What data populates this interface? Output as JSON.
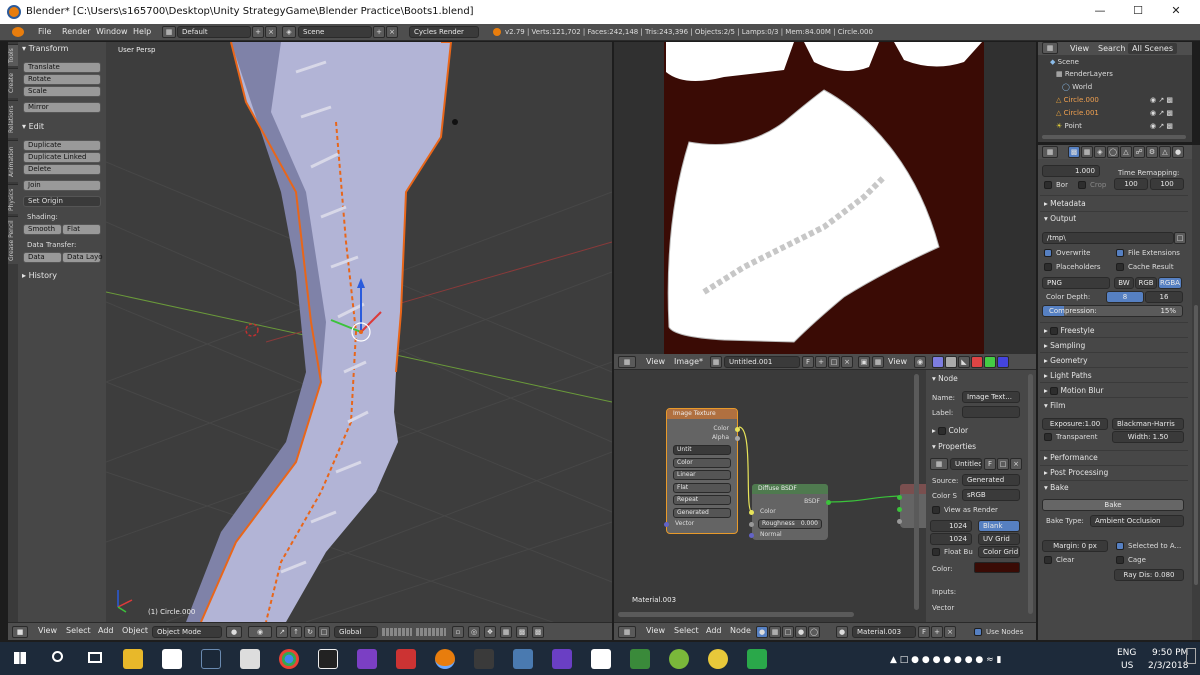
{
  "titlebar": {
    "title": "Blender* [C:\\Users\\s165700\\Desktop\\Unity StrategyGame\\Blender Practice\\Boots1.blend]"
  },
  "infobar": {
    "menus": [
      "File",
      "Render",
      "Window",
      "Help"
    ],
    "screen": "Default",
    "scene": "Scene",
    "engine": "Cycles Render",
    "stats": "v2.79 | Verts:121,702 | Faces:242,148 | Tris:243,396 | Objects:2/5 | Lamps:0/3 | Mem:84.00M | Circle.000"
  },
  "toolshelf": {
    "tabs": [
      "Tools",
      "Create",
      "Relations",
      "Animation",
      "Physics",
      "Grease Pencil"
    ],
    "transform_header": "Transform",
    "translate": "Translate",
    "rotate": "Rotate",
    "scale": "Scale",
    "mirror": "Mirror",
    "edit_header": "Edit",
    "duplicate": "Duplicate",
    "duplicate_linked": "Duplicate Linked",
    "delete": "Delete",
    "join": "Join",
    "set_origin": "Set Origin",
    "shading_label": "Shading:",
    "smooth": "Smooth",
    "flat": "Flat",
    "data_transfer_label": "Data Transfer:",
    "data": "Data",
    "data_layout": "Data Layo",
    "history_header": "History"
  },
  "viewport": {
    "view_label": "User Persp",
    "object_label": "(1) Circle.000",
    "menus": [
      "View",
      "Select",
      "Add",
      "Object"
    ],
    "mode": "Object Mode",
    "orientation": "Global"
  },
  "image_editor": {
    "menus": [
      "View",
      "Image*"
    ],
    "image_name": "Untitled.001",
    "view_menu": "View",
    "colors": {
      "background": "#3a0b05",
      "island": "#ffffff"
    }
  },
  "node_editor": {
    "image_texture": {
      "title": "Image Texture",
      "out_color": "Color",
      "out_alpha": "Alpha",
      "image_field": "Untit",
      "color_space": "Color",
      "interpolation": "Linear",
      "projection": "Flat",
      "extension": "Repeat",
      "source": "Generated",
      "in_vector": "Vector"
    },
    "diffuse": {
      "title": "Diffuse BSDF",
      "out_bsdf": "BSDF",
      "in_color": "Color",
      "roughness_label": "Roughness",
      "roughness_value": "0.000",
      "in_normal": "Normal"
    },
    "material_label": "Material.003",
    "footer_menus": [
      "View",
      "Select",
      "Add",
      "Node"
    ],
    "footer_material": "Material.003",
    "use_nodes": "Use Nodes"
  },
  "node_panel": {
    "node_header": "Node",
    "name_label": "Name:",
    "name_value": "Image Text...",
    "label_label": "Label:",
    "color_header": "Color",
    "properties_header": "Properties",
    "image_name": "Untitled.",
    "image_f": "F",
    "source_label": "Source:",
    "source_value": "Generated",
    "colorspace_label": "Color S",
    "colorspace_value": "sRGB",
    "view_as_render": "View as Render",
    "width": "1024",
    "height": "1024",
    "float_buffer": "Float Bu",
    "gen_types": [
      "Blank",
      "UV Grid",
      "Color Grid"
    ],
    "color_label": "Color:",
    "inputs_label": "Inputs:",
    "vector_label": "Vector"
  },
  "outliner": {
    "menus": [
      "View",
      "Search",
      "All Scenes"
    ],
    "items": [
      "Scene",
      "RenderLayers",
      "World",
      "Circle.000",
      "Circle.001",
      "Point"
    ]
  },
  "properties": {
    "y_label": "Y:",
    "y_value": "1.000",
    "time_remap": "Time Remapping:",
    "bor": "Bor",
    "crop": "Crop",
    "remap_old": "100",
    "remap_new": "100",
    "metadata": "Metadata",
    "output": "Output",
    "output_path": "/tmp\\",
    "overwrite": "Overwrite",
    "file_extensions": "File Extensions",
    "placeholders": "Placeholders",
    "cache_result": "Cache Result",
    "format": "PNG",
    "bw": "BW",
    "rgb": "RGB",
    "rgba": "RGBA",
    "color_depth": "Color Depth:",
    "depth8": "8",
    "depth16": "16",
    "compression": "Compression:",
    "compression_value": "15%",
    "freestyle": "Freestyle",
    "sampling": "Sampling",
    "geometry": "Geometry",
    "light_paths": "Light Paths",
    "motion_blur": "Motion Blur",
    "film": "Film",
    "exposure": "Exposure:",
    "exposure_value": "1.00",
    "filter": "Blackman-Harris",
    "transparent": "Transparent",
    "width_label": "Width:",
    "width_value": "1.50",
    "performance": "Performance",
    "post_processing": "Post Processing",
    "bake": "Bake",
    "bake_button": "Bake",
    "bake_type_label": "Bake Type:",
    "bake_type": "Ambient Occlusion",
    "margin_label": "Margin:",
    "margin_value": "0 px",
    "selected_to_active": "Selected to A...",
    "clear": "Clear",
    "cage": "Cage",
    "ray_dist": "Ray Dis: 0.080"
  },
  "taskbar": {
    "lang": "ENG",
    "region": "US",
    "time": "9:50 PM",
    "date": "2/3/2018"
  }
}
